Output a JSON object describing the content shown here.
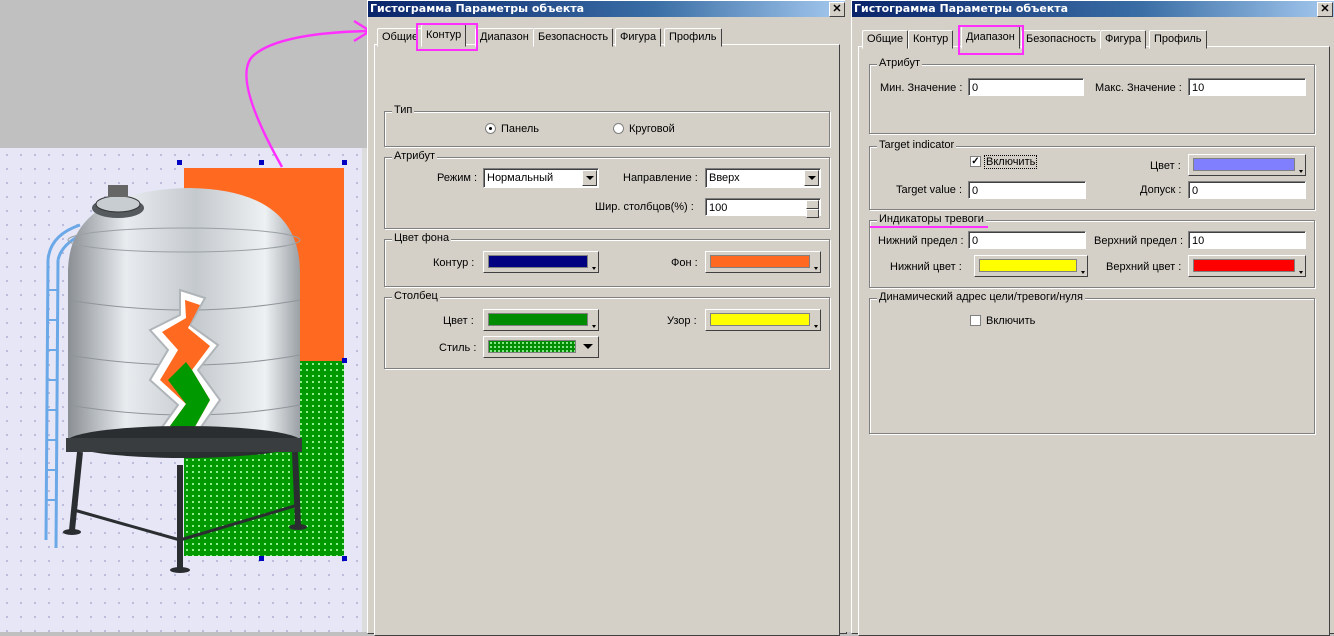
{
  "canvas": {
    "bar_colors": {
      "frame": "#ff6a20",
      "fill": "#009900",
      "pattern_dots": "#ffff66"
    }
  },
  "dialog_left": {
    "title": "Гистограмма Параметры объекта",
    "tabs": [
      "Общие",
      "Контур",
      "Диапазон",
      "Безопасность",
      "Фигура",
      "Профиль"
    ],
    "active_tab": "Контур",
    "type_group": {
      "label": "Тип",
      "options": [
        {
          "label": "Панель",
          "selected": true
        },
        {
          "label": "Круговой",
          "selected": false
        }
      ]
    },
    "attribute_group": {
      "label": "Атрибут",
      "mode_label": "Режим :",
      "mode_value": "Нормальный",
      "direction_label": "Направление :",
      "direction_value": "Вверх",
      "width_label": "Шир. столбцов(%) :",
      "width_value": "100"
    },
    "bg_color_group": {
      "label": "Цвет фона",
      "contour_label": "Контур :",
      "contour_color": "#000080",
      "bg_label": "Фон :",
      "bg_color": "#ff6a20"
    },
    "column_group": {
      "label": "Столбец",
      "color_label": "Цвет :",
      "color": "#008c00",
      "pattern_label": "Узор :",
      "pattern_color": "#ffff00",
      "style_label": "Стиль :"
    }
  },
  "dialog_right": {
    "title": "Гистограмма Параметры объекта",
    "tabs": [
      "Общие",
      "Контур",
      "Диапазон",
      "Безопасность",
      "Фигура",
      "Профиль"
    ],
    "active_tab": "Диапазон",
    "attribute_group": {
      "label": "Атрибут",
      "min_label": "Мин. Значение :",
      "min_value": "0",
      "max_label": "Макс. Значение :",
      "max_value": "10"
    },
    "target_group": {
      "label": "Target indicator",
      "enable_label": "Включить",
      "enabled": true,
      "color_label": "Цвет :",
      "color": "#8080ff",
      "target_label": "Target value :",
      "target_value": "0",
      "tolerance_label": "Допуск :",
      "tolerance_value": "0"
    },
    "alarm_group": {
      "label": "Индикаторы тревоги",
      "low_label": "Нижний предел :",
      "low_value": "0",
      "high_label": "Верхний предел :",
      "high_value": "10",
      "low_color_label": "Нижний цвет :",
      "low_color": "#ffff00",
      "high_color_label": "Верхний цвет :",
      "high_color": "#ff0000"
    },
    "dynamic_group": {
      "label": "Динамический адрес цели/тревоги/нуля",
      "enable_label": "Включить",
      "enabled": false
    }
  },
  "annotation_color": "#ff30ff"
}
